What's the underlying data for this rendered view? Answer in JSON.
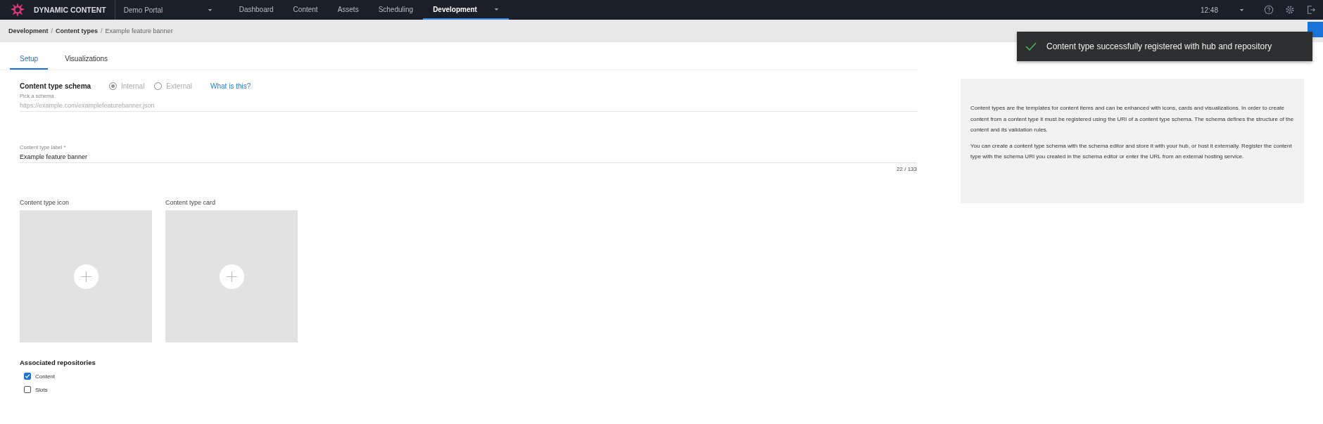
{
  "topbar": {
    "brand": "DYNAMIC CONTENT",
    "hub": "Demo Portal",
    "nav": [
      {
        "label": "Dashboard",
        "selected": false,
        "has_menu": false
      },
      {
        "label": "Content",
        "selected": false,
        "has_menu": false
      },
      {
        "label": "Assets",
        "selected": false,
        "has_menu": false
      },
      {
        "label": "Scheduling",
        "selected": false,
        "has_menu": false
      },
      {
        "label": "Development",
        "selected": true,
        "has_menu": true
      }
    ],
    "time": "12:48"
  },
  "breadcrumb_separator": "/",
  "breadcrumb": [
    {
      "label": "Development",
      "current": false
    },
    {
      "label": "Content types",
      "current": false
    },
    {
      "label": "Example feature banner",
      "current": true
    }
  ],
  "toast": {
    "message": "Content type successfully registered with hub and repository"
  },
  "tabs": [
    {
      "label": "Setup",
      "selected": true
    },
    {
      "label": "Visualizations",
      "selected": false
    }
  ],
  "schema": {
    "title": "Content type schema",
    "options": [
      {
        "label": "Internal",
        "selected": true,
        "disabled": true
      },
      {
        "label": "External",
        "selected": false,
        "disabled": true
      }
    ],
    "help_link": "What is this?",
    "field_label": "Pick a schema",
    "value": "https://example.com/examplefeaturebanner.json"
  },
  "label_field": {
    "label": "Content type label *",
    "value": "Example feature banner",
    "counter": "22 / 133"
  },
  "images": [
    {
      "label": "Content type icon"
    },
    {
      "label": "Content type card"
    }
  ],
  "repositories": {
    "title": "Associated repositories",
    "items": [
      {
        "label": "Content",
        "checked": true
      },
      {
        "label": "Slots",
        "checked": false
      }
    ]
  },
  "info": [
    "Content types are the templates for content items and can be enhanced with icons, cards and visualizations. In order to create content from a content type it must be registered using the URI of a content type schema. The schema defines the structure of the content and its validation rules.",
    "You can create a content type schema with the schema editor and store it with your hub, or host it externally. Register the content type with the schema URI you created in the schema editor or enter the URL from an external hosting service."
  ]
}
